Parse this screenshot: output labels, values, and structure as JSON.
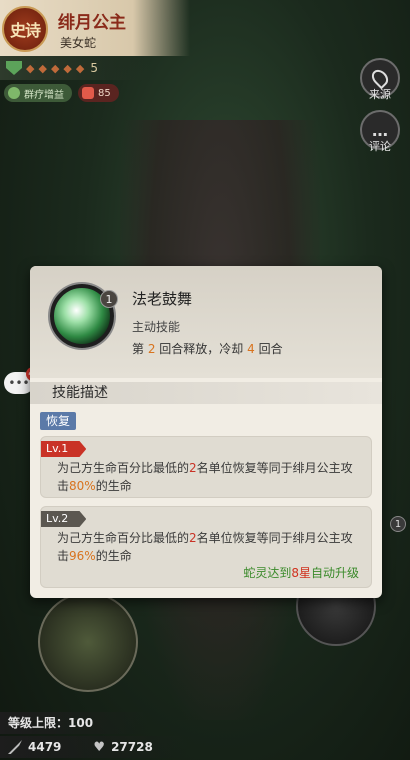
{
  "hero": {
    "rarity": "史诗",
    "name": "绯月公主",
    "title": "美女蛇",
    "star_count": "5",
    "tags": {
      "heal_label": "群疗增益",
      "likes": "85"
    }
  },
  "side_buttons": {
    "source_label": "来源",
    "comment_label": "评论"
  },
  "chat": {
    "unread": "44"
  },
  "skill": {
    "level_badge": "1",
    "name": "法老鼓舞",
    "type": "主动技能",
    "cooldown": {
      "prefix": "第 ",
      "round": "2",
      "mid": " 回合释放，冷却 ",
      "cd": "4",
      "suffix": " 回合"
    },
    "desc_header": "技能描述",
    "category": "恢复",
    "levels": [
      {
        "badge": "Lv.1",
        "text_a": "为己方生命百分比最低的",
        "count": "2",
        "text_b": "名单位恢复等同于绯月公主攻击",
        "pct": "80%",
        "text_c": "的生命"
      },
      {
        "badge": "Lv.2",
        "text_a": "为己方生命百分比最低的",
        "count": "2",
        "text_b": "名单位恢复等同于绯月公主攻击",
        "pct": "96%",
        "text_c": "的生命",
        "upgrade": {
          "prefix": "蛇灵达到",
          "stars": "8星",
          "suffix": "自动升级"
        }
      }
    ]
  },
  "right_badge": "1",
  "bottom": {
    "level_cap": "等级上限：100",
    "attack": "4479",
    "hp": "27728"
  },
  "colors": {
    "rarity_red": "#a03c1e",
    "highlight_orange": "#d8731e",
    "lv1_red": "#c93226",
    "upgrade_green": "#3a8a2a",
    "category_blue": "#5b7aa8"
  }
}
